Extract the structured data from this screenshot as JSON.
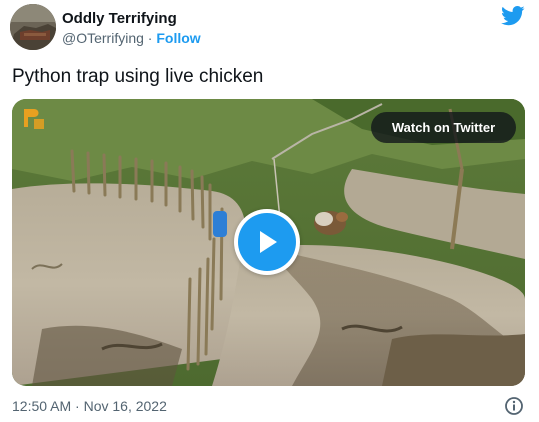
{
  "author": {
    "name": "Oddly Terrifying",
    "handle": "@OTerrifying",
    "separator": "·",
    "follow_label": "Follow"
  },
  "tweet": {
    "text": "Python trap using live chicken",
    "timestamp": "12:50 AM · Nov 16, 2022"
  },
  "media": {
    "watch_label": "Watch on Twitter",
    "play_icon": "play-icon"
  },
  "colors": {
    "accent": "#1d9bf0",
    "text": "#0f1419",
    "muted": "#536471"
  }
}
